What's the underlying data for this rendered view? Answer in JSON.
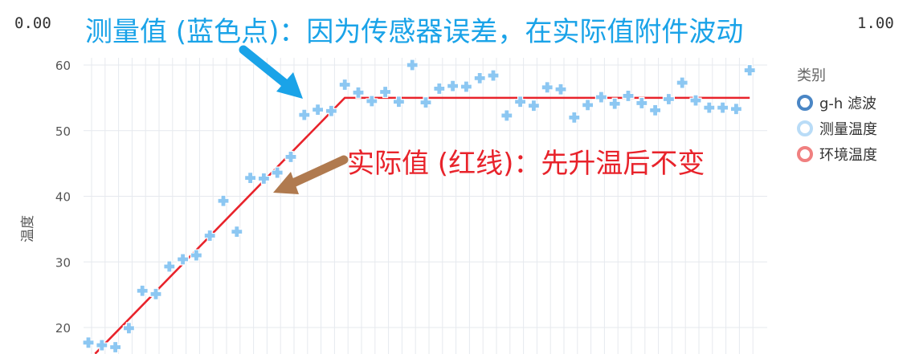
{
  "header": {
    "left_value": "0.00",
    "right_value": "1.00"
  },
  "annotations": {
    "blue": "测量值 (蓝色点)：因为传感器误差，在实际值附件波动",
    "red": "实际值 (红线)：先升温后不变"
  },
  "colors": {
    "measured": "#8cc7f2",
    "actual": "#e8232b",
    "filter": "#4a86c5",
    "blue_arrow": "#1aa3e8",
    "brown_arrow": "#b07a4f"
  },
  "legend": {
    "title": "类别",
    "items": [
      {
        "label": "g-h 滤波",
        "color": "#4a86c5"
      },
      {
        "label": "测量温度",
        "color": "#b9dcf7"
      },
      {
        "label": "环境温度",
        "color": "#f08080"
      }
    ]
  },
  "chart_data": {
    "type": "scatter",
    "ylabel": "温度",
    "xlabel": "",
    "ylim": [
      16,
      61
    ],
    "yticks": [
      20,
      30,
      40,
      50,
      60
    ],
    "grid": true,
    "legend_position": "right",
    "x": [
      0,
      1,
      2,
      3,
      4,
      5,
      6,
      7,
      8,
      9,
      10,
      11,
      12,
      13,
      14,
      15,
      16,
      17,
      18,
      19,
      20,
      21,
      22,
      23,
      24,
      25,
      26,
      27,
      28,
      29,
      30,
      31,
      32,
      33,
      34,
      35,
      36,
      37,
      38,
      39,
      40,
      41,
      42,
      43,
      44,
      45,
      46,
      47,
      48,
      49
    ],
    "series": [
      {
        "name": "测量温度",
        "marker": "plus",
        "values": [
          17.7,
          17.3,
          17.0,
          19.9,
          25.6,
          25.1,
          29.3,
          30.4,
          31.0,
          34.0,
          39.3,
          34.6,
          42.8,
          42.7,
          43.6,
          46.0,
          52.4,
          53.2,
          53.0,
          57.0,
          55.8,
          54.5,
          55.9,
          54.4,
          60.0,
          54.3,
          56.4,
          56.8,
          56.7,
          58.0,
          58.4,
          52.3,
          54.4,
          53.8,
          56.6,
          56.3,
          52.0,
          53.9,
          55.1,
          54.1,
          55.3,
          54.2,
          53.1,
          54.8,
          57.3,
          54.6,
          53.5,
          53.5,
          53.3,
          59.2
        ]
      },
      {
        "name": "环境温度",
        "type": "line",
        "points": [
          [
            0.5,
            16
          ],
          [
            19,
            55
          ],
          [
            49,
            55
          ]
        ]
      }
    ]
  }
}
